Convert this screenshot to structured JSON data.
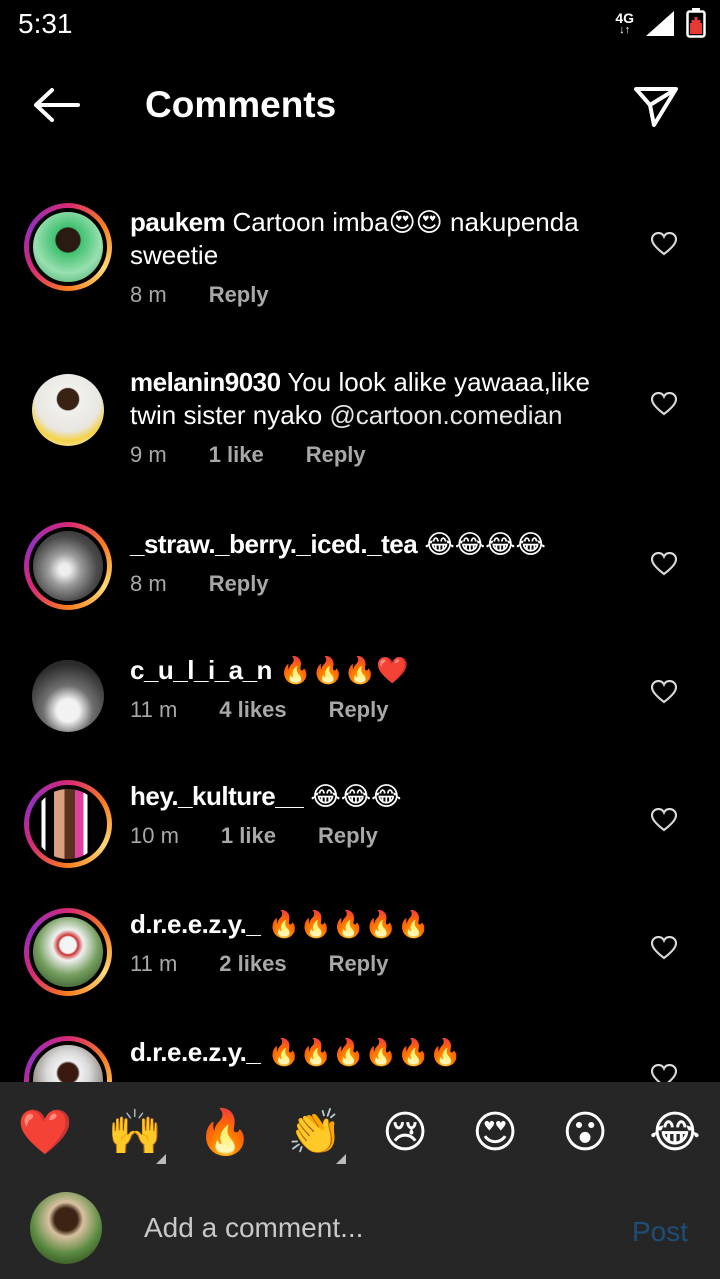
{
  "status_bar": {
    "time": "5:31",
    "network": "4G",
    "network_arrows": "↓↑",
    "icons": [
      "signal-icon",
      "battery-icon"
    ]
  },
  "header": {
    "title": "Comments",
    "back_icon": "back-arrow-icon",
    "send_icon": "send-icon"
  },
  "comments": [
    {
      "username": "paukem",
      "text": " Cartoon imba😍😍 nakupenda sweetie",
      "time": "8 m",
      "likes": "",
      "reply_label": "Reply",
      "has_story": true
    },
    {
      "username": "melanin9030",
      "text": " You look alike yawaaa,like twin sister nyako ",
      "mention": "@cartoon.comedian",
      "time": "9 m",
      "likes": "1 like",
      "reply_label": "Reply",
      "has_story": false
    },
    {
      "username": "_straw._berry._iced._tea",
      "text": " 😂😂😂😂",
      "time": "8 m",
      "likes": "",
      "reply_label": "Reply",
      "has_story": true
    },
    {
      "username": "c_u_l_i_a_n",
      "text": " 🔥🔥🔥❤️",
      "time": "11 m",
      "likes": "4 likes",
      "reply_label": "Reply",
      "has_story": false
    },
    {
      "username": "hey._kulture__",
      "text": " 😂😂😂",
      "time": "10 m",
      "likes": "1 like",
      "reply_label": "Reply",
      "has_story": true
    },
    {
      "username": "d.r.e.e.z.y._",
      "text": " 🔥🔥🔥🔥🔥",
      "time": "11 m",
      "likes": "2 likes",
      "reply_label": "Reply",
      "has_story": true
    },
    {
      "username": "d.r.e.e.z.y._",
      "text": " 🔥🔥🔥🔥🔥🔥",
      "time": "",
      "likes": "",
      "reply_label": "",
      "has_story": true
    }
  ],
  "reactions": [
    "❤️",
    "🙌",
    "🔥",
    "👏",
    "😢",
    "😍",
    "😮",
    "😂"
  ],
  "composer": {
    "placeholder": "Add a comment...",
    "post_label": "Post"
  },
  "colors": {
    "background": "#000000",
    "reaction_bar": "#262626",
    "meta_text": "#a8a8a8",
    "post_disabled": "#1e4e78"
  }
}
